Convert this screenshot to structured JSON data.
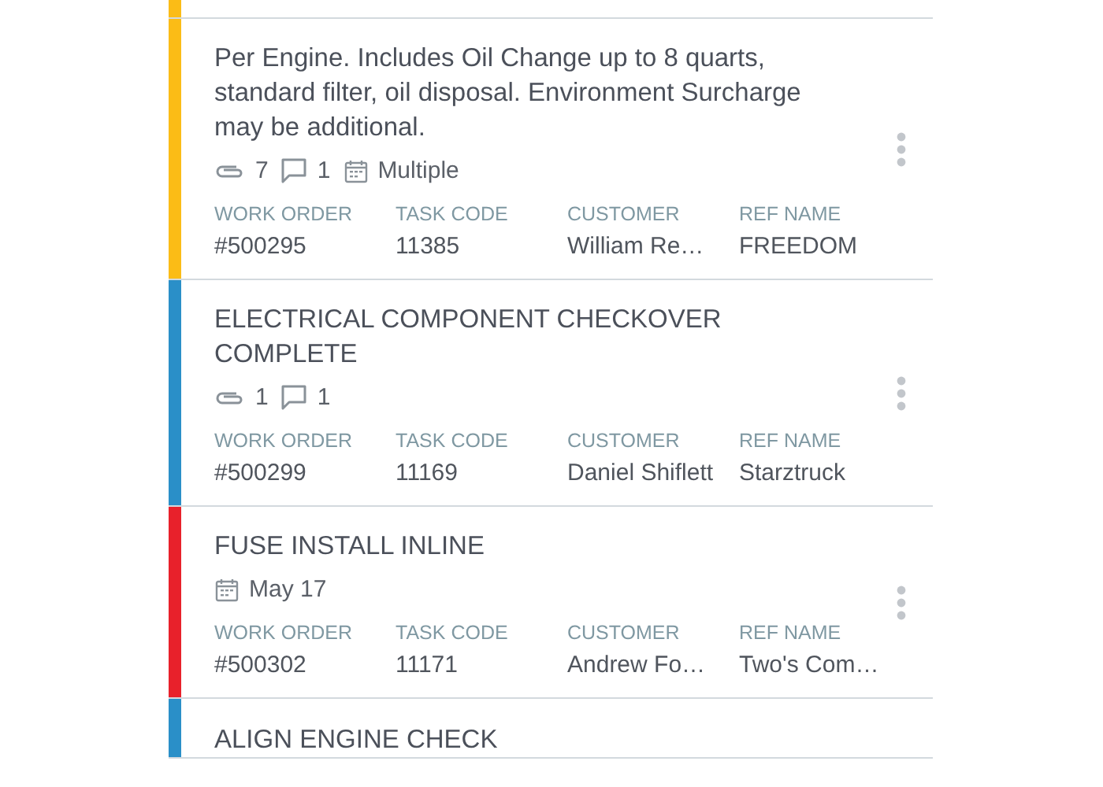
{
  "tasks": [
    {
      "color": "#fbbc16"
    },
    {
      "color": "#fbbc16",
      "title": "Per Engine. Includes Oil Change up to 8 quarts, standard filter, oil disposal. Environment Surcharge may be additional.",
      "meta": [
        {
          "kind": "attachments",
          "text": "7"
        },
        {
          "kind": "comments",
          "text": "1"
        },
        {
          "kind": "date",
          "text": "Multiple"
        }
      ],
      "fields": [
        {
          "label": "WORK ORDER",
          "value": "#500295"
        },
        {
          "label": "TASK CODE",
          "value": "11385"
        },
        {
          "label": "CUSTOMER",
          "value": "William Re…"
        },
        {
          "label": "REF NAME",
          "value": "FREEDOM"
        }
      ]
    },
    {
      "color": "#2a8fc8",
      "title": "ELECTRICAL COMPONENT CHECKOVER COMPLETE",
      "meta": [
        {
          "kind": "attachments",
          "text": "1"
        },
        {
          "kind": "comments",
          "text": "1"
        }
      ],
      "fields": [
        {
          "label": "WORK ORDER",
          "value": "#500299"
        },
        {
          "label": "TASK CODE",
          "value": "11169"
        },
        {
          "label": "CUSTOMER",
          "value": "Daniel Shiflett"
        },
        {
          "label": "REF NAME",
          "value": "Starztruck"
        }
      ]
    },
    {
      "color": "#e8212b",
      "title": "FUSE INSTALL INLINE",
      "meta": [
        {
          "kind": "date",
          "text": "May 17"
        }
      ],
      "fields": [
        {
          "label": "WORK ORDER",
          "value": "#500302"
        },
        {
          "label": "TASK CODE",
          "value": "11171"
        },
        {
          "label": "CUSTOMER",
          "value": "Andrew Fo…"
        },
        {
          "label": "REF NAME",
          "value": "Two's Com…"
        }
      ]
    },
    {
      "color": "#2a8fc8",
      "title": "ALIGN ENGINE CHECK"
    }
  ]
}
